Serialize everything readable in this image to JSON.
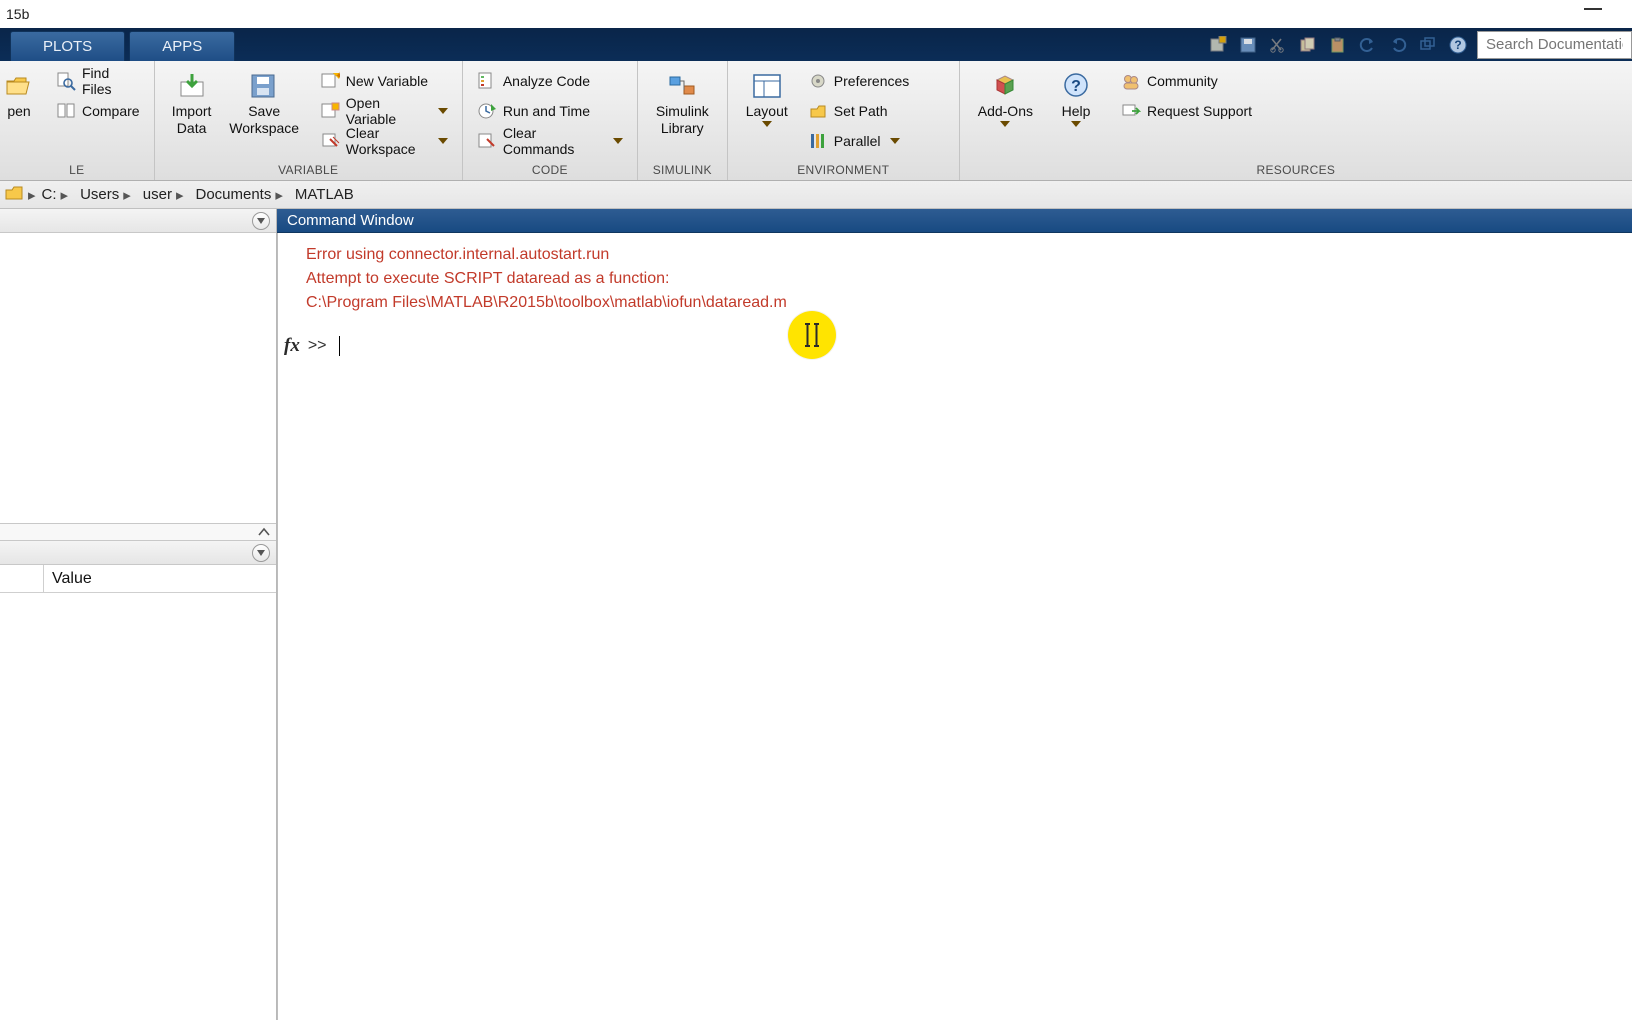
{
  "titlebar": {
    "text": "15b"
  },
  "tabs": {
    "plots": "PLOTS",
    "apps": "APPS"
  },
  "search": {
    "placeholder": "Search Documentatio"
  },
  "toolstrip": {
    "file": {
      "label": "LE",
      "open": "pen",
      "find_files": "Find Files",
      "compare": "Compare",
      "import_data_l1": "Import",
      "import_data_l2": "Data",
      "save_ws_l1": "Save",
      "save_ws_l2": "Workspace"
    },
    "variable": {
      "label": "VARIABLE",
      "new_var": "New Variable",
      "open_var": "Open Variable",
      "clear_ws": "Clear Workspace"
    },
    "code": {
      "label": "CODE",
      "analyze": "Analyze Code",
      "run_time": "Run and Time",
      "clear_cmds": "Clear Commands"
    },
    "simulink": {
      "label": "SIMULINK",
      "btn_l1": "Simulink",
      "btn_l2": "Library"
    },
    "environment": {
      "label": "ENVIRONMENT",
      "layout": "Layout",
      "preferences": "Preferences",
      "set_path": "Set Path",
      "parallel": "Parallel"
    },
    "resources": {
      "label": "RESOURCES",
      "addons": "Add-Ons",
      "help": "Help",
      "community": "Community",
      "request_support": "Request Support"
    }
  },
  "address": {
    "segs": [
      "C:",
      "Users",
      "user",
      "Documents",
      "MATLAB"
    ]
  },
  "workspace": {
    "col_value": "Value"
  },
  "command_window": {
    "title": "Command Window",
    "err1": "Error using connector.internal.autostart.run",
    "err2": "Attempt to execute SCRIPT dataread as a function:",
    "err3": "C:\\Program Files\\MATLAB\\R2015b\\toolbox\\matlab\\iofun\\dataread.m",
    "prompt": ">>"
  }
}
